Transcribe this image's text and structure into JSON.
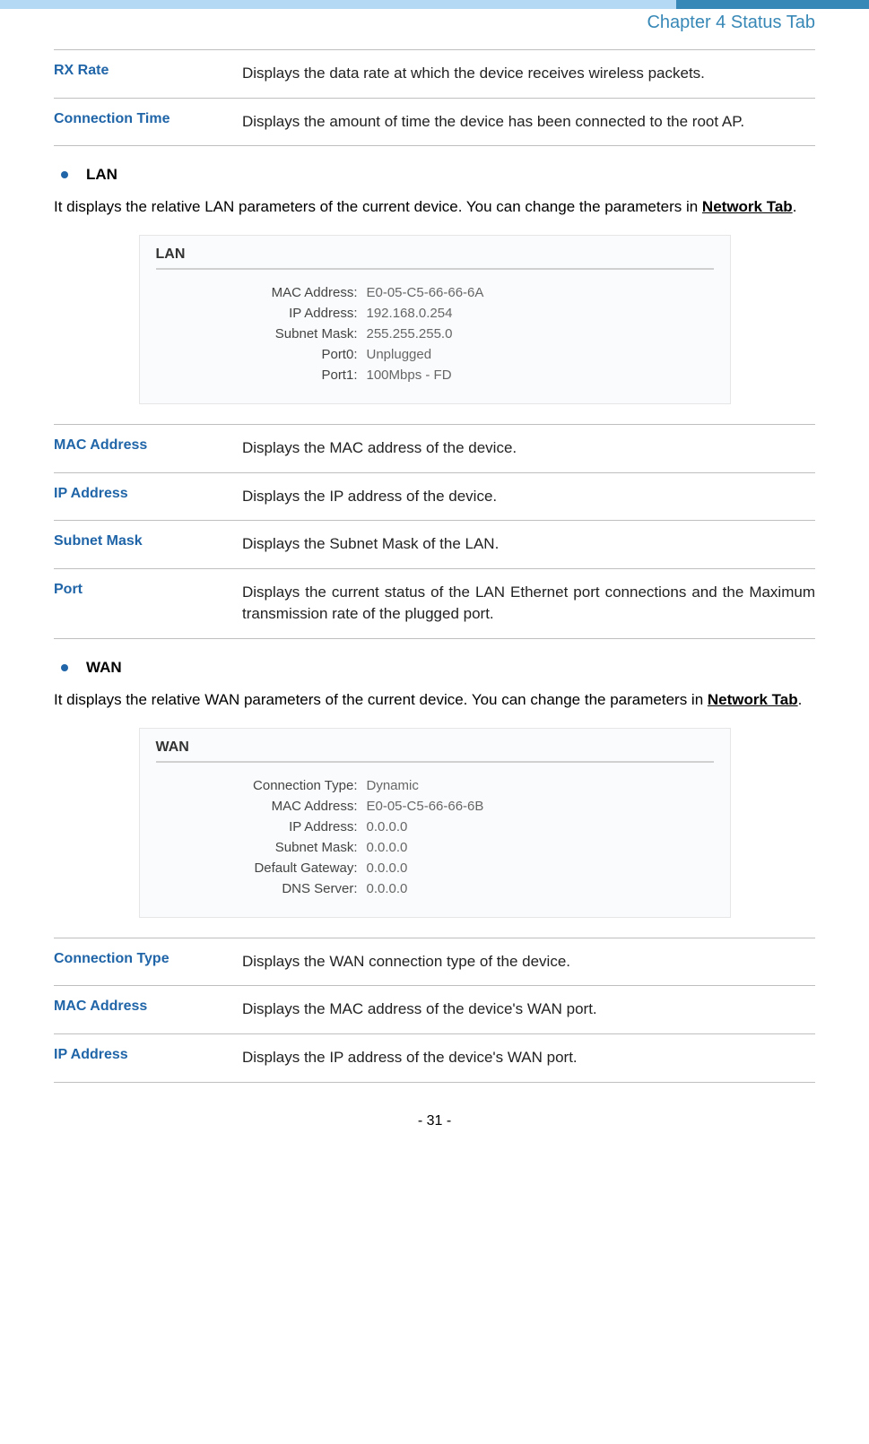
{
  "chapter": "Chapter 4 Status Tab",
  "topDefs": [
    {
      "term": "RX Rate",
      "desc": "Displays the data rate at which the device receives wireless packets."
    },
    {
      "term": "Connection Time",
      "desc": "Displays the amount of time the device has been connected to the root AP."
    }
  ],
  "lan": {
    "heading": "LAN",
    "paraPrefix": "It displays the relative LAN parameters of the current device. You can change the parameters in ",
    "paraLink": "Network Tab",
    "paraSuffix": ".",
    "panelTitle": "LAN",
    "rows": [
      {
        "label": "MAC Address:",
        "value": "E0-05-C5-66-66-6A"
      },
      {
        "label": "IP Address:",
        "value": "192.168.0.254"
      },
      {
        "label": "Subnet Mask:",
        "value": "255.255.255.0"
      },
      {
        "label": "Port0:",
        "value": "Unplugged"
      },
      {
        "label": "Port1:",
        "value": "100Mbps - FD"
      }
    ],
    "defs": [
      {
        "term": "MAC Address",
        "desc": "Displays the MAC address of the device."
      },
      {
        "term": "IP Address",
        "desc": "Displays the IP address of the device."
      },
      {
        "term": "Subnet Mask",
        "desc": "Displays the Subnet Mask of the LAN."
      },
      {
        "term": "Port",
        "desc": "Displays the current status of the LAN Ethernet port connections and the Maximum transmission rate of the plugged port.",
        "justify": true
      }
    ]
  },
  "wan": {
    "heading": "WAN",
    "paraPrefix": "It displays the relative WAN parameters of the current device. You can change the parameters in ",
    "paraLink": "Network Tab",
    "paraSuffix": ".",
    "panelTitle": "WAN",
    "rows": [
      {
        "label": "Connection Type:",
        "value": "Dynamic"
      },
      {
        "label": "MAC Address:",
        "value": "E0-05-C5-66-66-6B"
      },
      {
        "label": "IP Address:",
        "value": "0.0.0.0"
      },
      {
        "label": "Subnet Mask:",
        "value": "0.0.0.0"
      },
      {
        "label": "Default Gateway:",
        "value": "0.0.0.0"
      },
      {
        "label": "DNS Server:",
        "value": "0.0.0.0"
      }
    ],
    "defs": [
      {
        "term": "Connection Type",
        "desc": "Displays the WAN connection type of the device."
      },
      {
        "term": "MAC Address",
        "desc": "Displays the MAC address of the device's WAN port."
      },
      {
        "term": "IP Address",
        "desc": "Displays the IP address of the device's WAN port."
      }
    ]
  },
  "pageNumber": "- 31 -"
}
